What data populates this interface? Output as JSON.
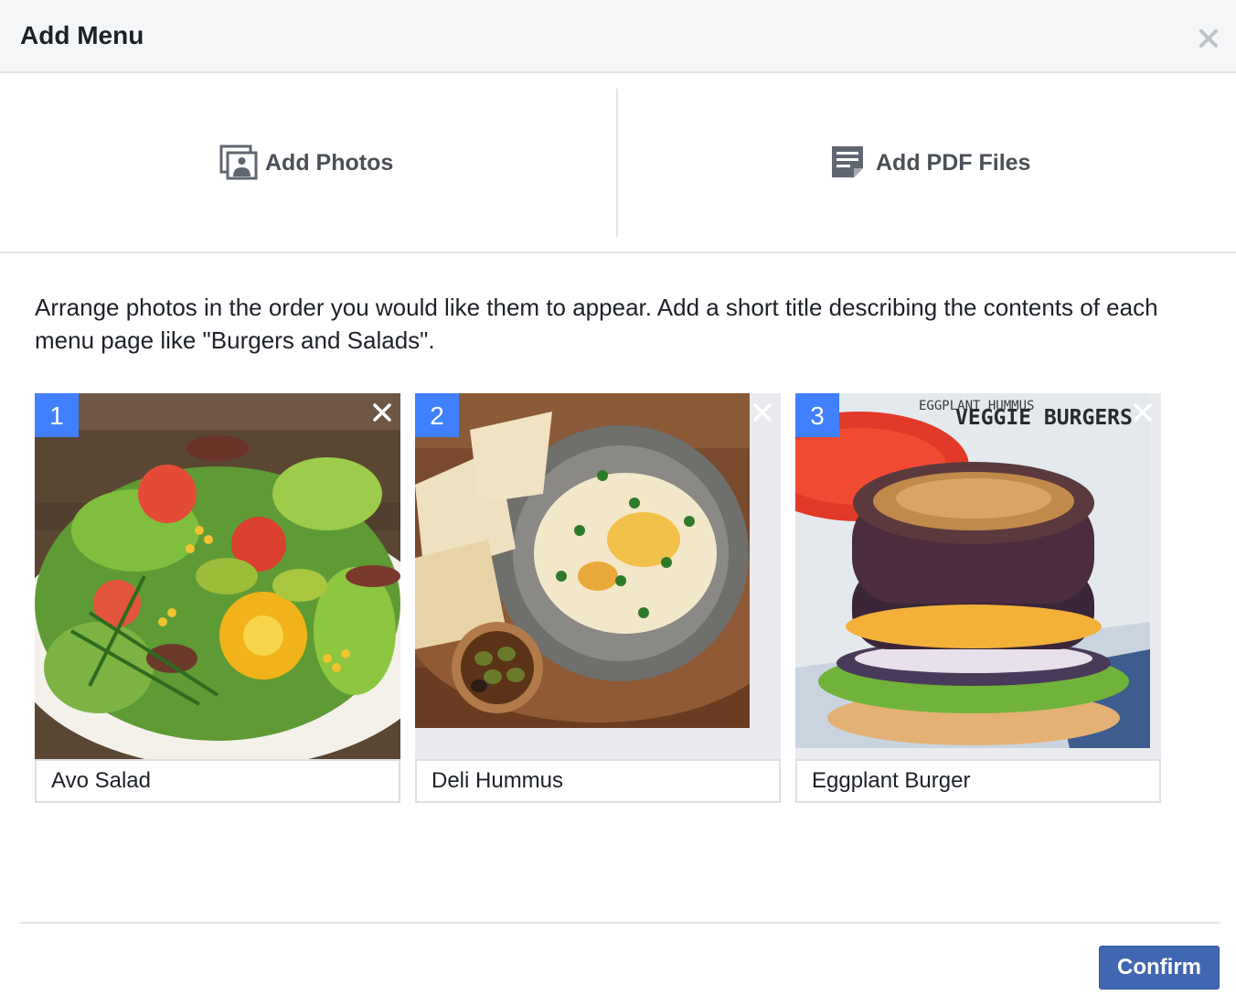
{
  "dialog": {
    "title": "Add Menu",
    "close_icon": "close-icon"
  },
  "upload": {
    "photos_label": "Add Photos",
    "photos_icon": "photos-icon",
    "pdf_label": "Add PDF Files",
    "pdf_icon": "pdf-file-icon"
  },
  "instructions": "Arrange photos in the order you would like them to appear. Add a short title describing the contents of each menu page like \"Burgers and Salads\".",
  "photos": [
    {
      "number": "1",
      "title": "Avo Salad",
      "image": "salad photo"
    },
    {
      "number": "2",
      "title": "Deli Hummus",
      "image": "hummus photo"
    },
    {
      "number": "3",
      "title": "Eggplant Burger",
      "image": "eggplant burger photo",
      "image_text": "EGGPLANT HUMMUS VEGGIE BURGERS"
    }
  ],
  "footer": {
    "confirm_label": "Confirm"
  },
  "colors": {
    "accent": "#4080ff",
    "confirm": "#4267b2",
    "header_bg": "#f5f6f7"
  }
}
